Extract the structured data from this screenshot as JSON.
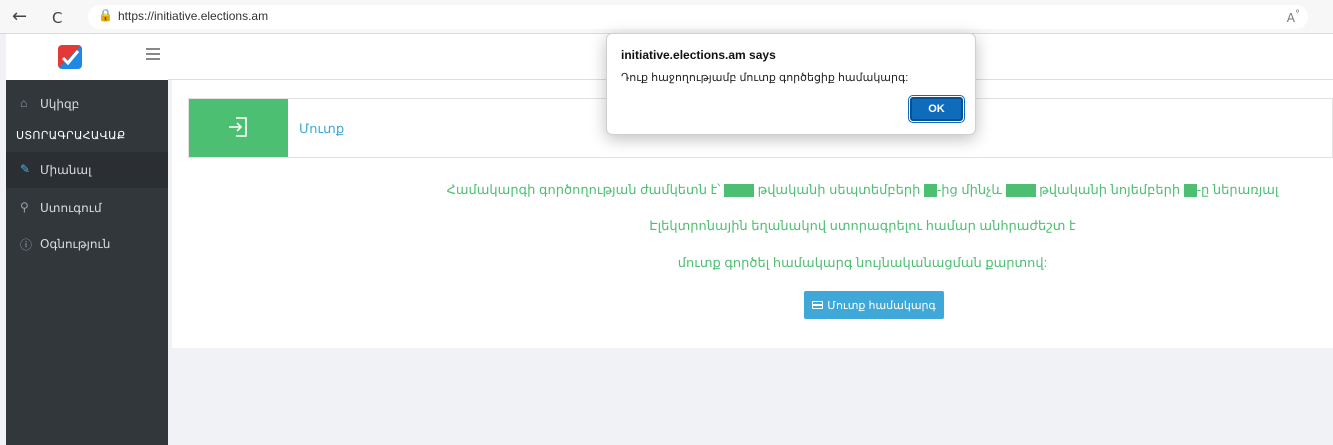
{
  "browser": {
    "url": "https://initiative.elections.am",
    "back_icon": "←",
    "reload_icon": "C",
    "lock_icon": "🔒",
    "read_aloud_icon": "A",
    "read_aloud_sup": "°"
  },
  "sidebar": {
    "heading": "ՍՏՈՐԱԳՐԱՀԱՎԱՔ",
    "items": [
      {
        "label": "Սկիզբ",
        "icon": "home-icon",
        "glyph": "⌂"
      },
      {
        "label": "Միանալ",
        "icon": "edit-icon",
        "glyph": "✎",
        "active": true
      },
      {
        "label": "Ստուգում",
        "icon": "search-icon",
        "glyph": "⚲"
      },
      {
        "label": "Օգնություն",
        "icon": "info-icon",
        "glyph": "ⓘ"
      }
    ]
  },
  "login_card": {
    "label": "Մուտք"
  },
  "message": {
    "line1_a": "Համակարգի գործողության ժամկետն է՝",
    "line1_b": "թվականի սեպտեմբերի",
    "line1_c": "-ից մինչև",
    "line1_d": "թվականի նոյեմբերի",
    "line1_e": "-ը ներառյալ",
    "line2": "Էլեկտրոնային եղանակով ստորագրելու համար անհրաժեշտ է",
    "line3": "մուտք գործել համակարգ նույնականացման քարտով:"
  },
  "login_button": {
    "label": "Մուտք համակարգ"
  },
  "dialog": {
    "title": "initiative.elections.am says",
    "message": "Դուք հաջողությամբ մուտք գործեցիք համակարգ:",
    "ok_label": "OK"
  },
  "colors": {
    "accent_green": "#4dbf72",
    "accent_blue": "#3fa8d8",
    "sidebar_bg": "#32373c",
    "ok_button": "#0f6cbd"
  }
}
